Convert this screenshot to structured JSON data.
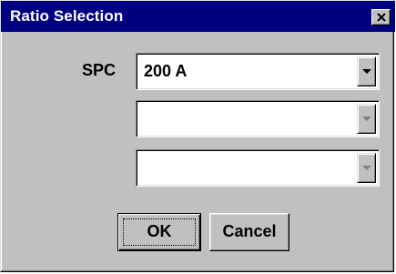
{
  "window": {
    "title": "Ratio Selection",
    "close_icon": "close-icon"
  },
  "form": {
    "spc_label": "SPC",
    "spc_value": "200 A",
    "combo2_value": "",
    "combo3_value": ""
  },
  "buttons": {
    "ok_label": "OK",
    "cancel_label": "Cancel"
  },
  "colors": {
    "titlebar": "#000080",
    "face": "#c0c0c0",
    "field": "#ffffff"
  }
}
